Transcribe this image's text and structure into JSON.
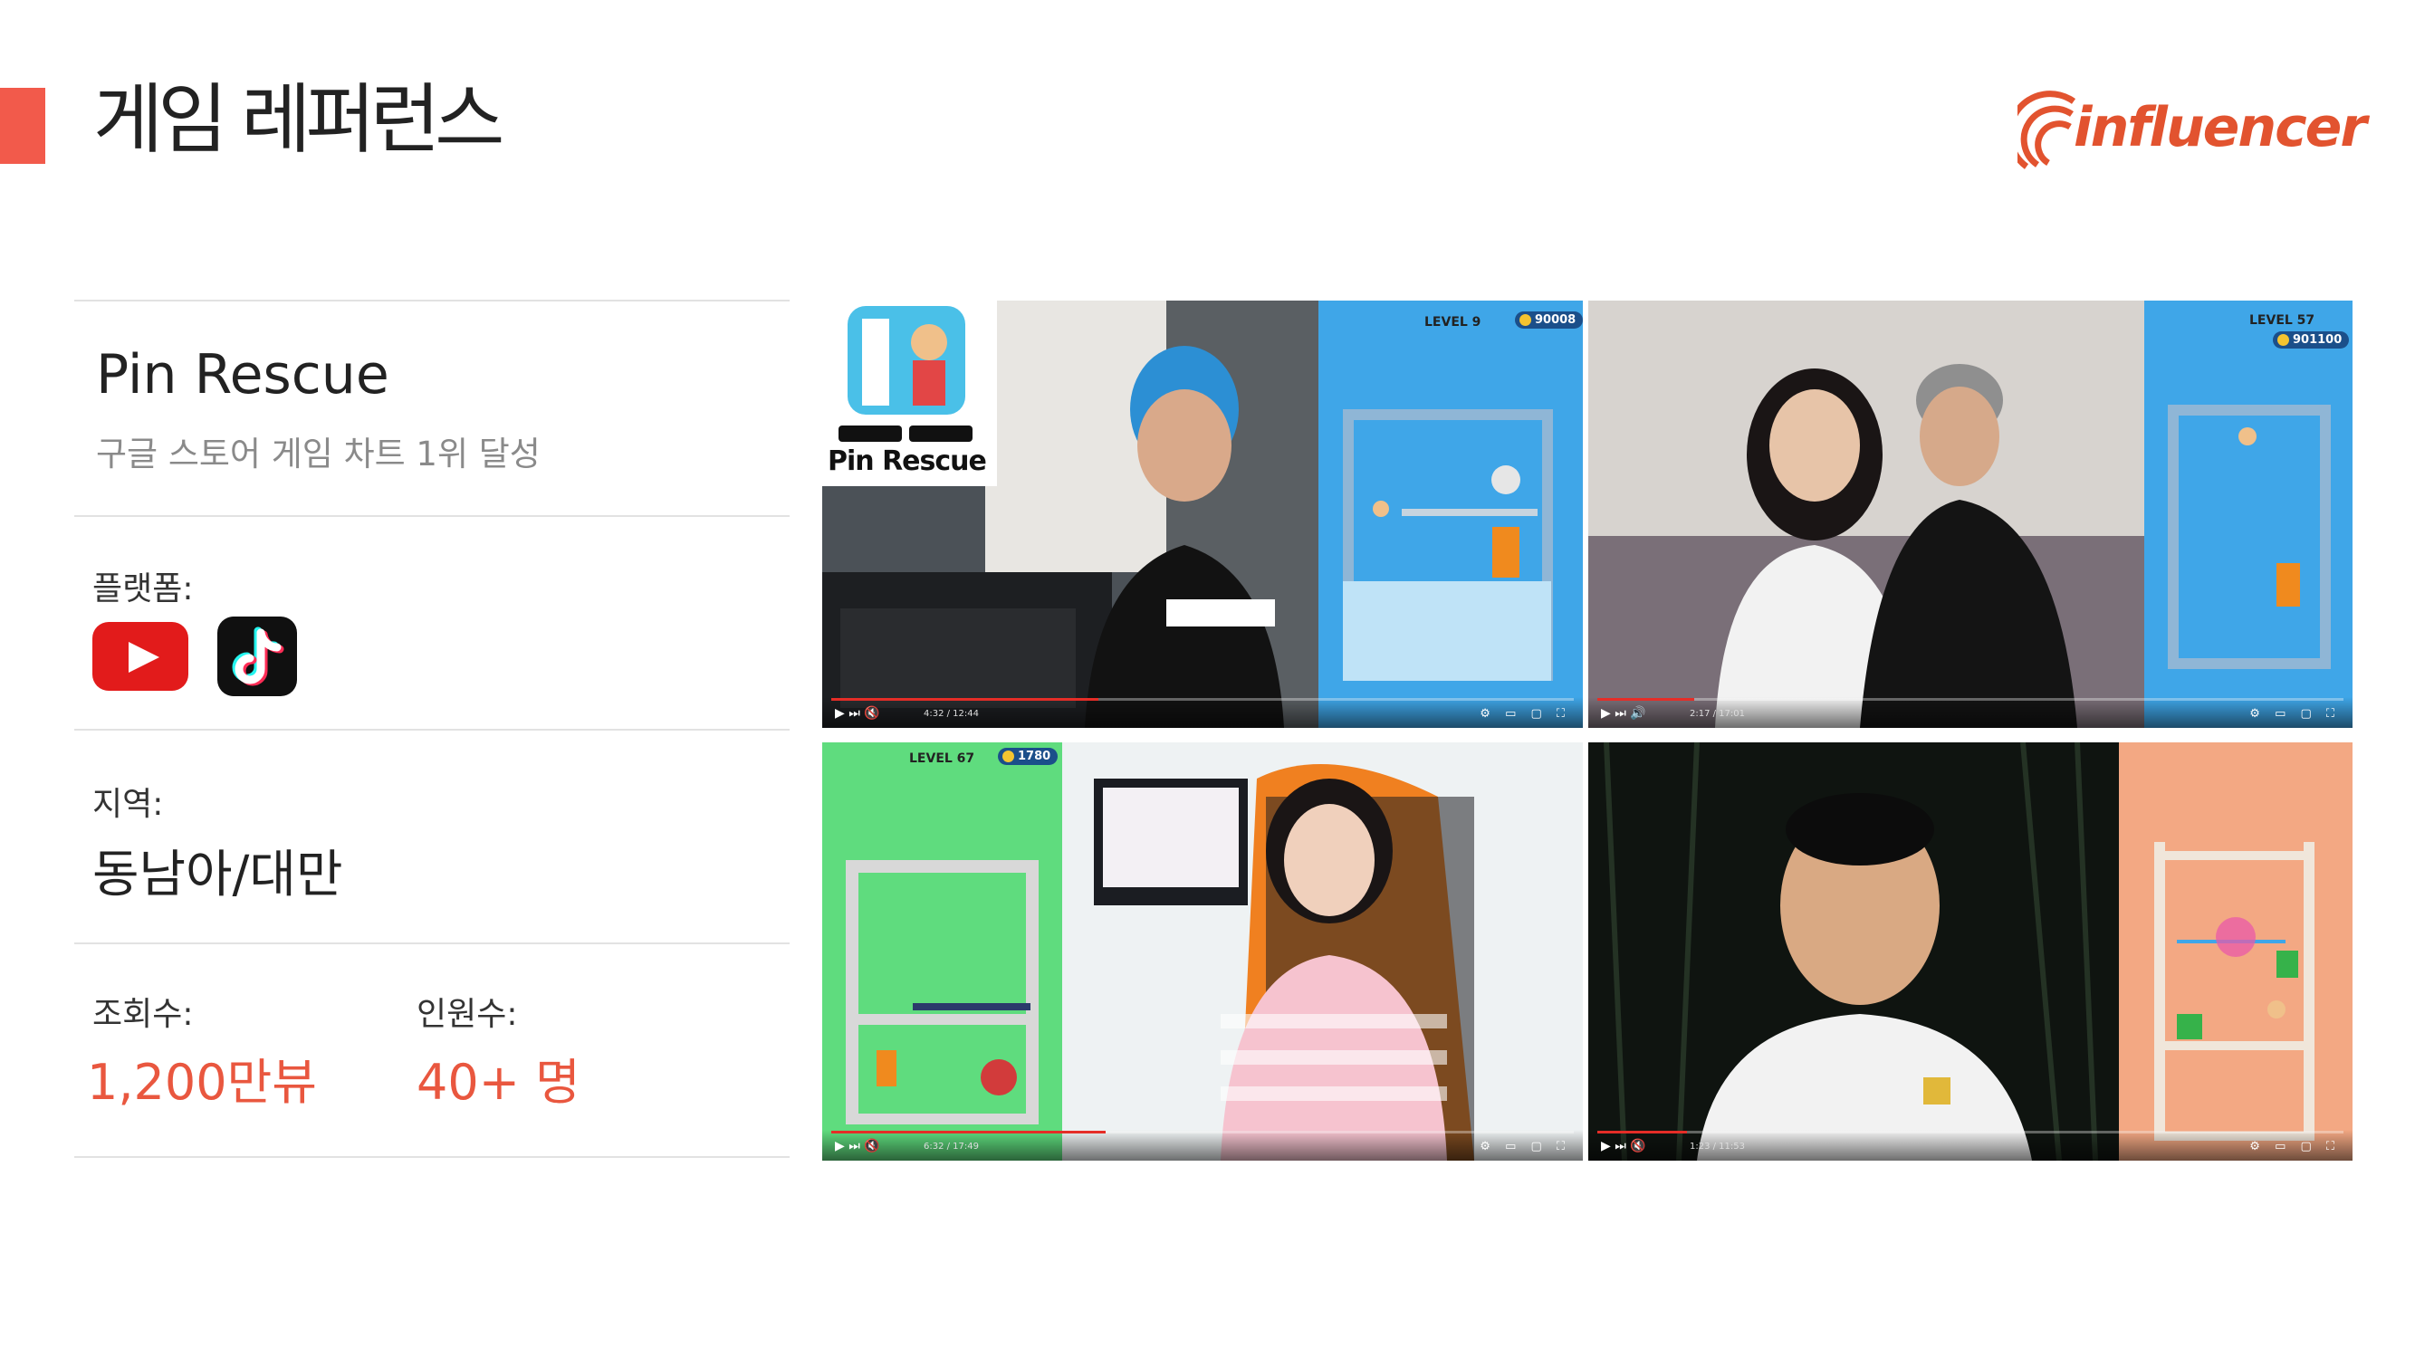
{
  "page": {
    "title": "게임 레퍼런스"
  },
  "brand": {
    "logo_text": "influencer",
    "accent_color": "#f25a4b",
    "logo_color": "#e2532f"
  },
  "game": {
    "name": "Pin Rescue",
    "subtitle": "구글 스토어 게임 차트 1위 달성"
  },
  "platform": {
    "label": "플랫폼:",
    "icons": [
      "youtube-icon",
      "tiktok-icon"
    ]
  },
  "region": {
    "label": "지역:",
    "value": "동남아/대만"
  },
  "stats": {
    "views_label": "조회수:",
    "views_value": "1,200만뷰",
    "people_label": "인원수:",
    "people_value": "40+ 명",
    "value_color": "#e9573f"
  },
  "videos": [
    {
      "level": "LEVEL 9",
      "coins": "90008",
      "time": "4:32 / 12:44",
      "badge_title": "Pin Rescue",
      "progress": 0.36
    },
    {
      "level": "LEVEL 57",
      "coins": "901100",
      "time": "2:17 / 17:01",
      "progress": 0.13
    },
    {
      "level": "LEVEL 67",
      "coins": "1780",
      "time": "6:32 / 17:49",
      "progress": 0.37
    },
    {
      "time": "1:23 / 11:53",
      "progress": 0.12
    }
  ]
}
